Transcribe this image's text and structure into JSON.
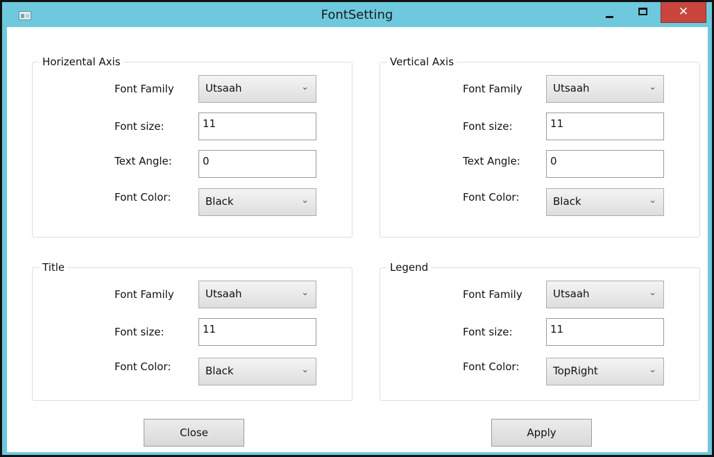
{
  "window": {
    "title": "FontSetting",
    "close_glyph": "✕"
  },
  "groups": {
    "horizontal": {
      "title": "Horizental Axis",
      "font_family_label": "Font Family",
      "font_family_value": "Utsaah",
      "font_size_label": "Font size:",
      "font_size_value": "11",
      "text_angle_label": "Text Angle:",
      "text_angle_value": "0",
      "font_color_label": "Font Color:",
      "font_color_value": "Black"
    },
    "vertical": {
      "title": "Vertical Axis",
      "font_family_label": "Font Family",
      "font_family_value": "Utsaah",
      "font_size_label": "Font size:",
      "font_size_value": "11",
      "text_angle_label": "Text Angle:",
      "text_angle_value": "0",
      "font_color_label": "Font Color:",
      "font_color_value": "Black"
    },
    "title": {
      "title": "Title",
      "font_family_label": "Font Family",
      "font_family_value": "Utsaah",
      "font_size_label": "Font size:",
      "font_size_value": "11",
      "font_color_label": "Font Color:",
      "font_color_value": "Black"
    },
    "legend": {
      "title": "Legend",
      "font_family_label": "Font Family",
      "font_family_value": "Utsaah",
      "font_size_label": "Font size:",
      "font_size_value": "11",
      "font_color_label": "Font Color:",
      "font_color_value": "TopRight"
    }
  },
  "buttons": {
    "close_label": "Close",
    "apply_label": "Apply"
  },
  "icons": {
    "chevron": "⌄"
  },
  "colors": {
    "window_frame": "#6ec9dd",
    "close_button": "#c9453e"
  }
}
